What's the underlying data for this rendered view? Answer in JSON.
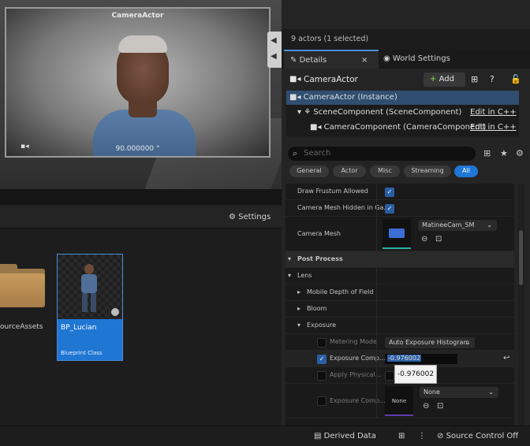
{
  "viewport": {
    "camera_title": "CameraActor",
    "fov_readout": "90.000000 °"
  },
  "outliner": {
    "actor_count": "9 actors (1 selected)"
  },
  "tabs": {
    "details": "Details",
    "world_settings": "World Settings",
    "close_glyph": "×"
  },
  "details": {
    "actor_name": "CameraActor",
    "add_label": "Add",
    "components": [
      {
        "label": "CameraActor (Instance)",
        "link": ""
      },
      {
        "label": "SceneComponent (SceneComponent)",
        "link": "Edit in C++"
      },
      {
        "label": "CameraComponent (CameraComponent)",
        "link": "Edit in C++"
      }
    ],
    "search_placeholder": "Search",
    "filters": [
      "General",
      "Actor",
      "Misc",
      "Streaming",
      "All"
    ],
    "active_filter": "All",
    "properties": {
      "draw_frustum": "Draw Frustum Allowed",
      "camera_mesh_hidden": "Camera Mesh Hidden in Ga...",
      "camera_mesh": "Camera Mesh",
      "camera_mesh_value": "MatineeCam_SM",
      "post_process": "Post Process",
      "lens": "Lens",
      "mobile_dof": "Mobile Depth of Field",
      "bloom": "Bloom",
      "exposure": "Exposure",
      "metering_mode": "Metering Mode",
      "metering_mode_value": "Auto Exposure Histogram",
      "exposure_comp": "Exposure Comp...",
      "exposure_comp_value": "-0.976002",
      "apply_physical": "Apply Physical...",
      "exposure_comp_curve": "Exposure Comp...",
      "none_thumb": "None",
      "none_value": "None"
    }
  },
  "tooltip": {
    "value": "-0.976002"
  },
  "content_browser": {
    "settings_label": "Settings",
    "folder_label": "ourceAssets",
    "asset_name": "BP_Lucian",
    "asset_type": "Blueprint Class"
  },
  "statusbar": {
    "derived_data": "Derived Data",
    "source_control": "Source Control Off"
  },
  "colors": {
    "accent": "#1f76d3",
    "selection": "#2f4e70",
    "panel": "#242424"
  }
}
